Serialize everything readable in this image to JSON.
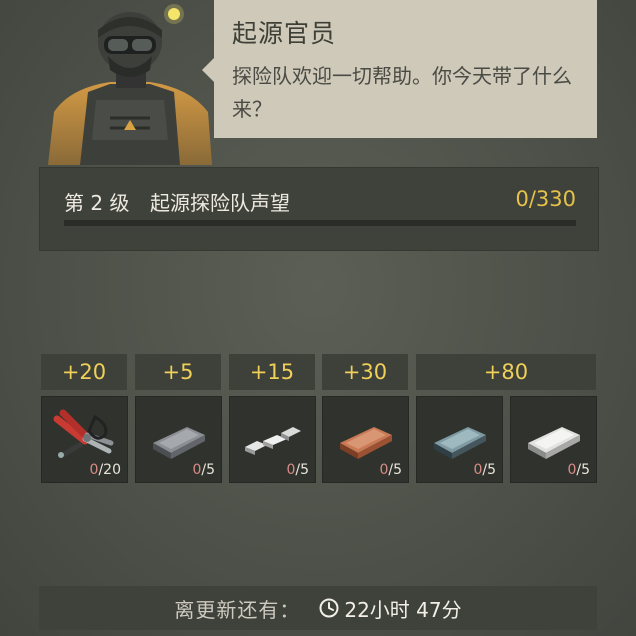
{
  "npc": {
    "name": "起源官员",
    "dialog": "探险队欢迎一切帮助。你今天带了什么来？"
  },
  "reputation": {
    "level_label": "第 2 级",
    "faction_label": "起源探险队声望",
    "progress_text": "0/330",
    "current": 0,
    "max": 330,
    "fill_color": "#e6c24a"
  },
  "rewards": [
    {
      "label": "+20"
    },
    {
      "label": "+5"
    },
    {
      "label": "+15"
    },
    {
      "label": "+30"
    },
    {
      "label": "+80"
    }
  ],
  "items": [
    {
      "icon": "tools-icon",
      "current": "0",
      "max": "/20"
    },
    {
      "icon": "iron-ingot-icon",
      "current": "0",
      "max": "/5"
    },
    {
      "icon": "silver-nuggets-icon",
      "current": "0",
      "max": "/5"
    },
    {
      "icon": "copper-ingot-icon",
      "current": "0",
      "max": "/5"
    },
    {
      "icon": "steel-ingot-icon",
      "current": "0",
      "max": "/5"
    },
    {
      "icon": "silver-ingot-icon",
      "current": "0",
      "max": "/5"
    }
  ],
  "refresh": {
    "label": "离更新还有：",
    "icon": "clock-icon",
    "time": "22小时 47分"
  }
}
